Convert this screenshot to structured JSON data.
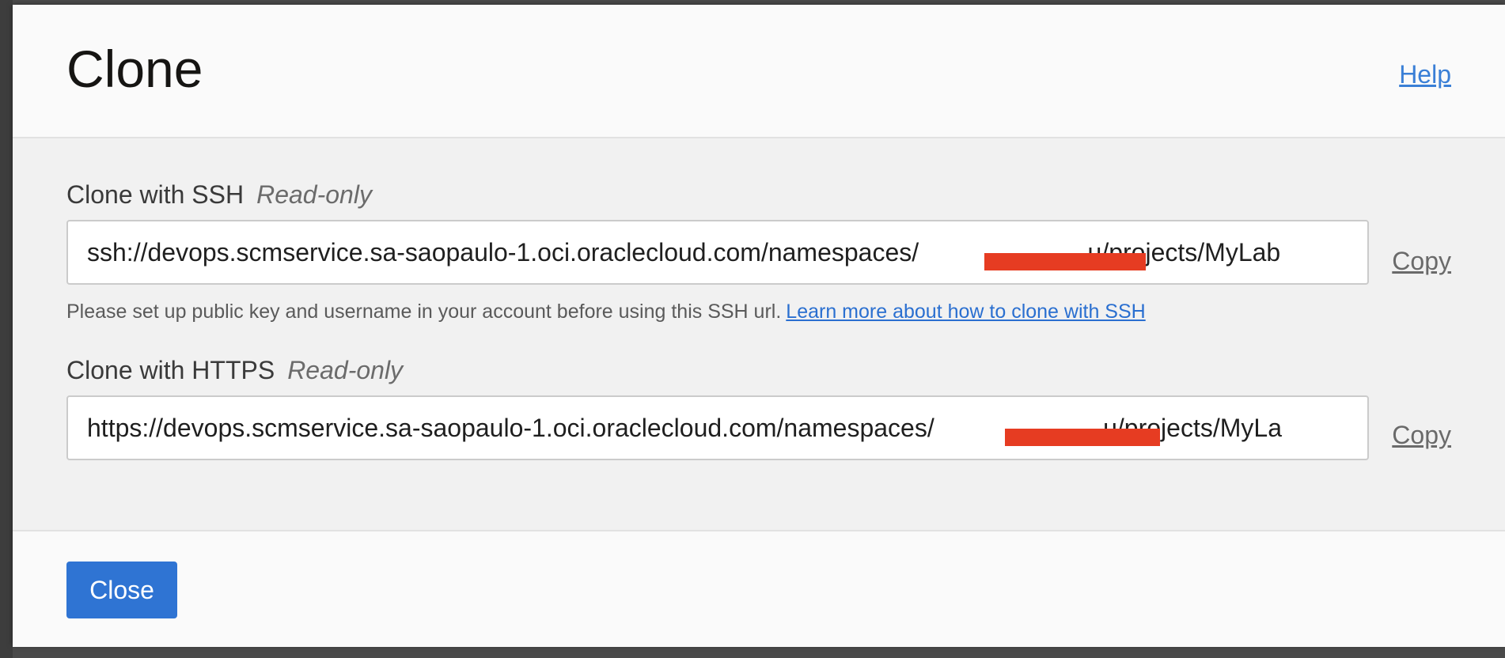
{
  "dialog": {
    "title": "Clone",
    "help_label": "Help"
  },
  "ssh": {
    "label": "Clone with SSH",
    "readonly_label": "Read-only",
    "url": "ssh://devops.scmservice.sa-saopaulo-1.oci.oraclecloud.com/namespaces/                        u/projects/MyLab",
    "copy_label": "Copy",
    "hint_text": "Please set up public key and username in your account before using this SSH url.",
    "hint_link": "Learn more about how to clone with SSH"
  },
  "https": {
    "label": "Clone with HTTPS",
    "readonly_label": "Read-only",
    "url": "https://devops.scmservice.sa-saopaulo-1.oci.oraclecloud.com/namespaces/                        u/projects/MyLa",
    "copy_label": "Copy"
  },
  "footer": {
    "close_label": "Close"
  },
  "colors": {
    "accent": "#2f74d3",
    "link": "#3a7fd6",
    "redaction": "#e63c22"
  }
}
